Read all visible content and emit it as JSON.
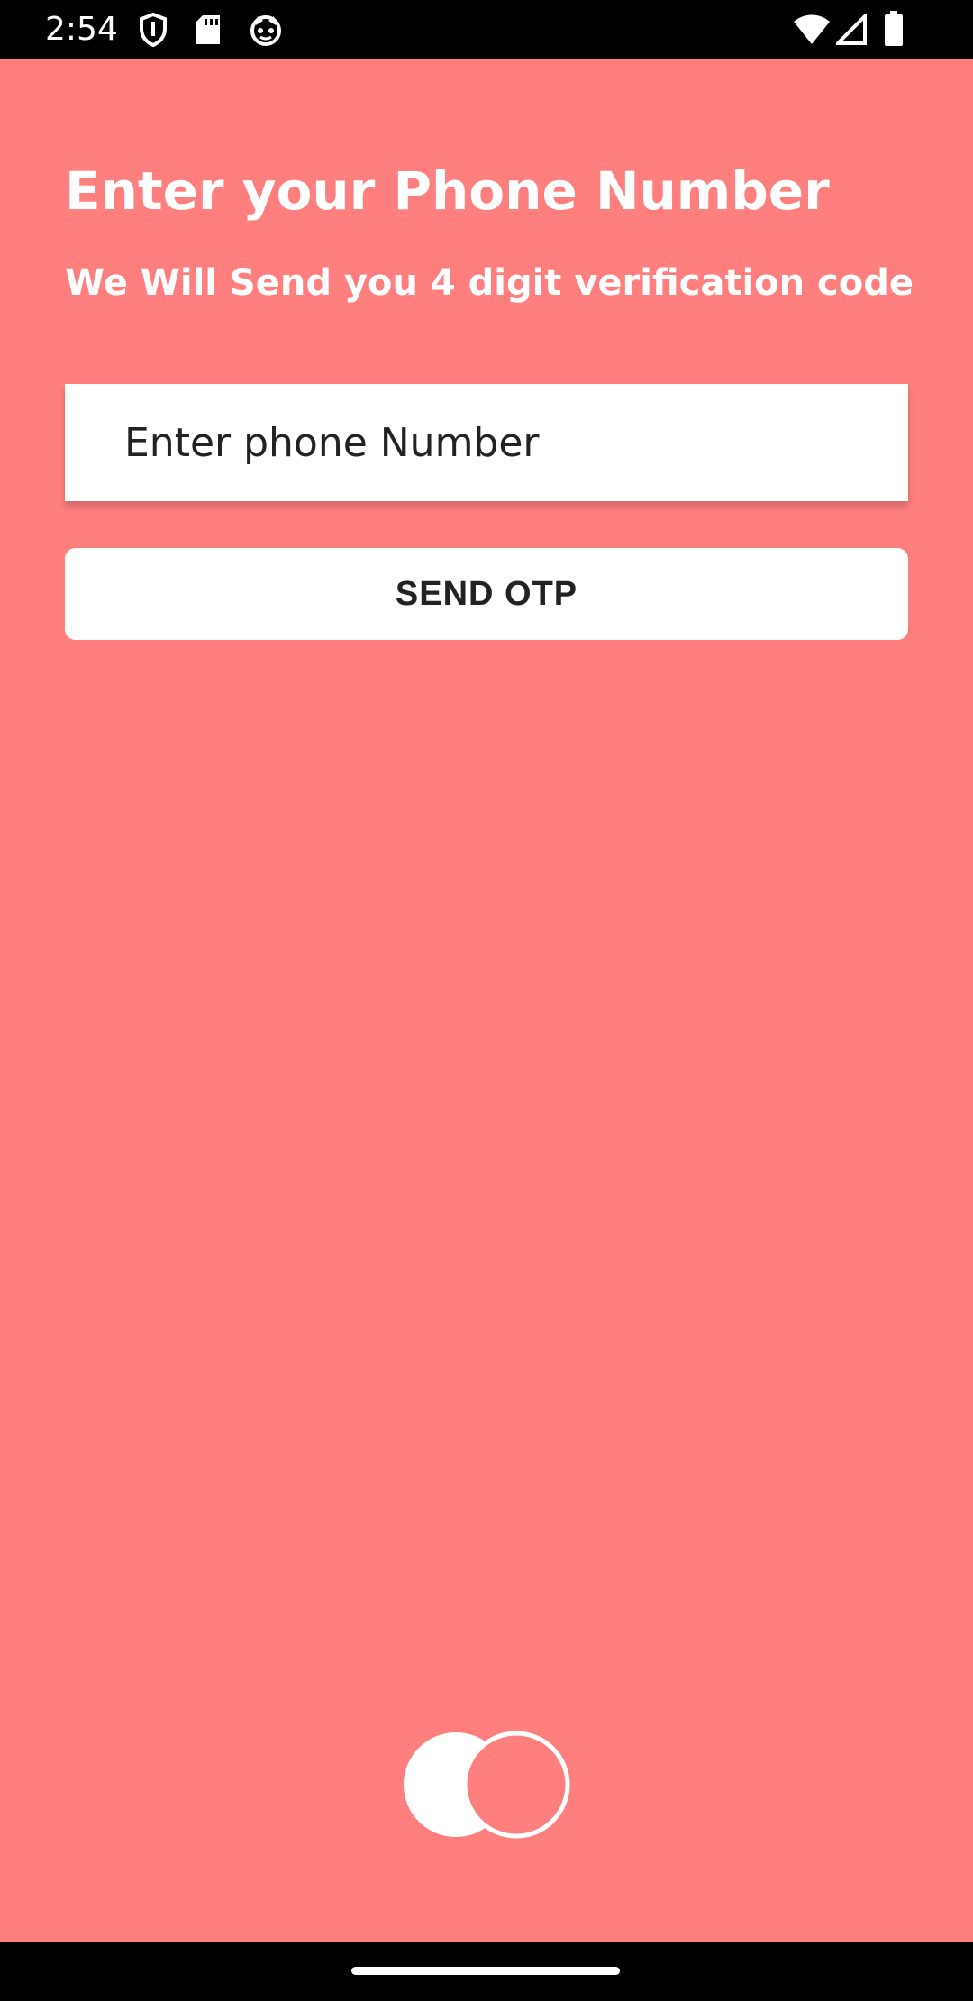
{
  "status_bar": {
    "time": "2:54",
    "icons": [
      "shield-icon",
      "sd-card-icon",
      "cat-face-icon",
      "wifi-icon",
      "signal-icon",
      "battery-icon"
    ]
  },
  "colors": {
    "background": "#FF7F7F",
    "text_on_bg": "#FFFFFF",
    "button_bg": "#FFFFFF",
    "button_text": "#222222"
  },
  "main": {
    "title": "Enter your Phone Number",
    "subtitle": "We Will Send you 4 digit verification code",
    "phone_input": {
      "placeholder": "Enter phone Number",
      "value": ""
    },
    "send_button_label": "SEND OTP"
  },
  "footer": {
    "logo_icon": "toggle-icon"
  }
}
